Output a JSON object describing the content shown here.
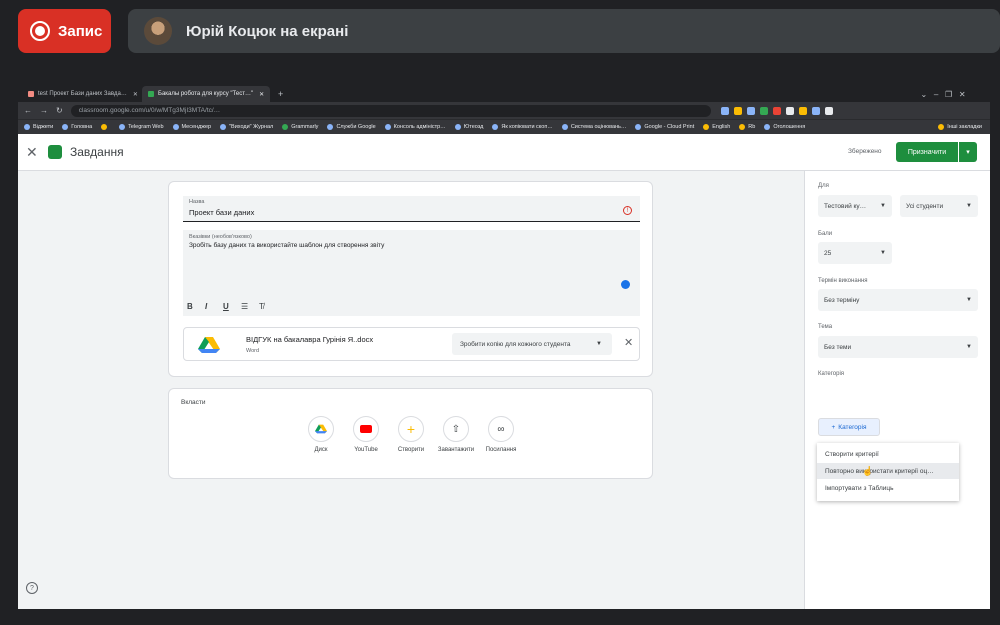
{
  "meeting": {
    "record_label": "Запис",
    "presenter_text": "Юрій Коцюк на екрані"
  },
  "browser": {
    "tabs": [
      {
        "label": "test Проект Бази даних Завда…",
        "active": false
      },
      {
        "label": "Бакалы робота для курсу \"Тест…\"",
        "active": true
      }
    ],
    "new_tab": "+",
    "url": "classroom.google.com/u/0/w/MTg3MjI3MTA/tc/…",
    "bookmarks": [
      "Віджети",
      "Головна",
      "",
      "Telegram Web",
      "Месенджер",
      "\"Виходи\" Журнал",
      "Grammarly",
      "Служби Google",
      "Консоль адміністр…",
      "Ютеозд",
      "Як копіювати скоп…",
      "Система оцінювань…",
      "Google - Cloud Print",
      "English",
      "Rb",
      "Оголошення",
      "Інші закладки"
    ]
  },
  "classroom": {
    "page_title": "Завдання",
    "saved_label": "Збережено",
    "assign_button": "Призначити",
    "title_field": {
      "label": "Назва",
      "value": "Проект бази даних"
    },
    "description_field": {
      "label": "Вказівки (необов'язково)",
      "value": "Зробіть базу даних та використайте шаблон для створення звіту"
    },
    "format_buttons": [
      "B",
      "I",
      "U",
      "☰",
      "T̸"
    ],
    "attachment": {
      "name": "ВІДГУК на бакалавра Гурінія Я..docx",
      "type": "Word",
      "copy_mode": "Зробити копію для кожного студента"
    },
    "attach_section_label": "Вкласти",
    "attach_buttons": [
      "Диск",
      "YouTube",
      "Створити",
      "Завантажити",
      "Посилання"
    ],
    "side": {
      "for_label": "Для",
      "course_value": "Тестовий ку…",
      "students_value": "Усі студенти",
      "points_label": "Бали",
      "points_value": "25",
      "due_label": "Термін виконання",
      "due_value": "Без терміну",
      "topic_label": "Тема",
      "topic_value": "Без теми",
      "rubric_label": "Категорія",
      "rubric_button": "Категорія",
      "rubric_menu": [
        "Створити критерії",
        "Повторно використати критерії оц…",
        "Імпортувати з Таблиць"
      ]
    }
  },
  "colors": {
    "record_red": "#d93025",
    "classroom_green": "#1e8e3e"
  }
}
